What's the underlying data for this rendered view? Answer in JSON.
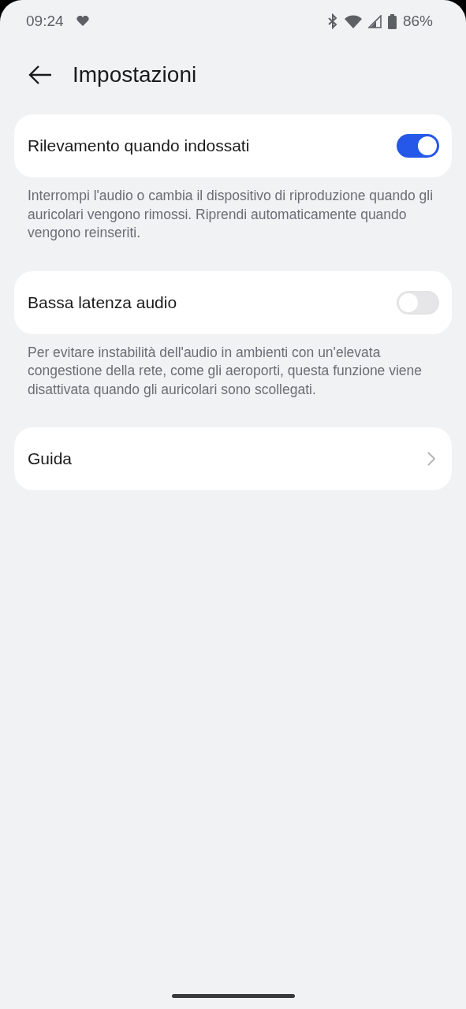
{
  "status_bar": {
    "time": "09:24",
    "battery": "86%"
  },
  "header": {
    "title": "Impostazioni"
  },
  "items": [
    {
      "kind": "toggle",
      "label": "Rilevamento quando indossati",
      "on": true,
      "description": "Interrompi l'audio o cambia il dispositivo di riproduzione quando gli auricolari vengono rimossi. Riprendi automaticamente quando vengono reinseriti."
    },
    {
      "kind": "toggle",
      "label": "Bassa latenza audio",
      "on": false,
      "description": "Per evitare instabilità dell'audio in ambienti con un'elevata congestione della rete, come gli aeroporti, questa funzione viene disattivata quando gli auricolari sono scollegati."
    },
    {
      "kind": "link",
      "label": "Guida"
    }
  ]
}
